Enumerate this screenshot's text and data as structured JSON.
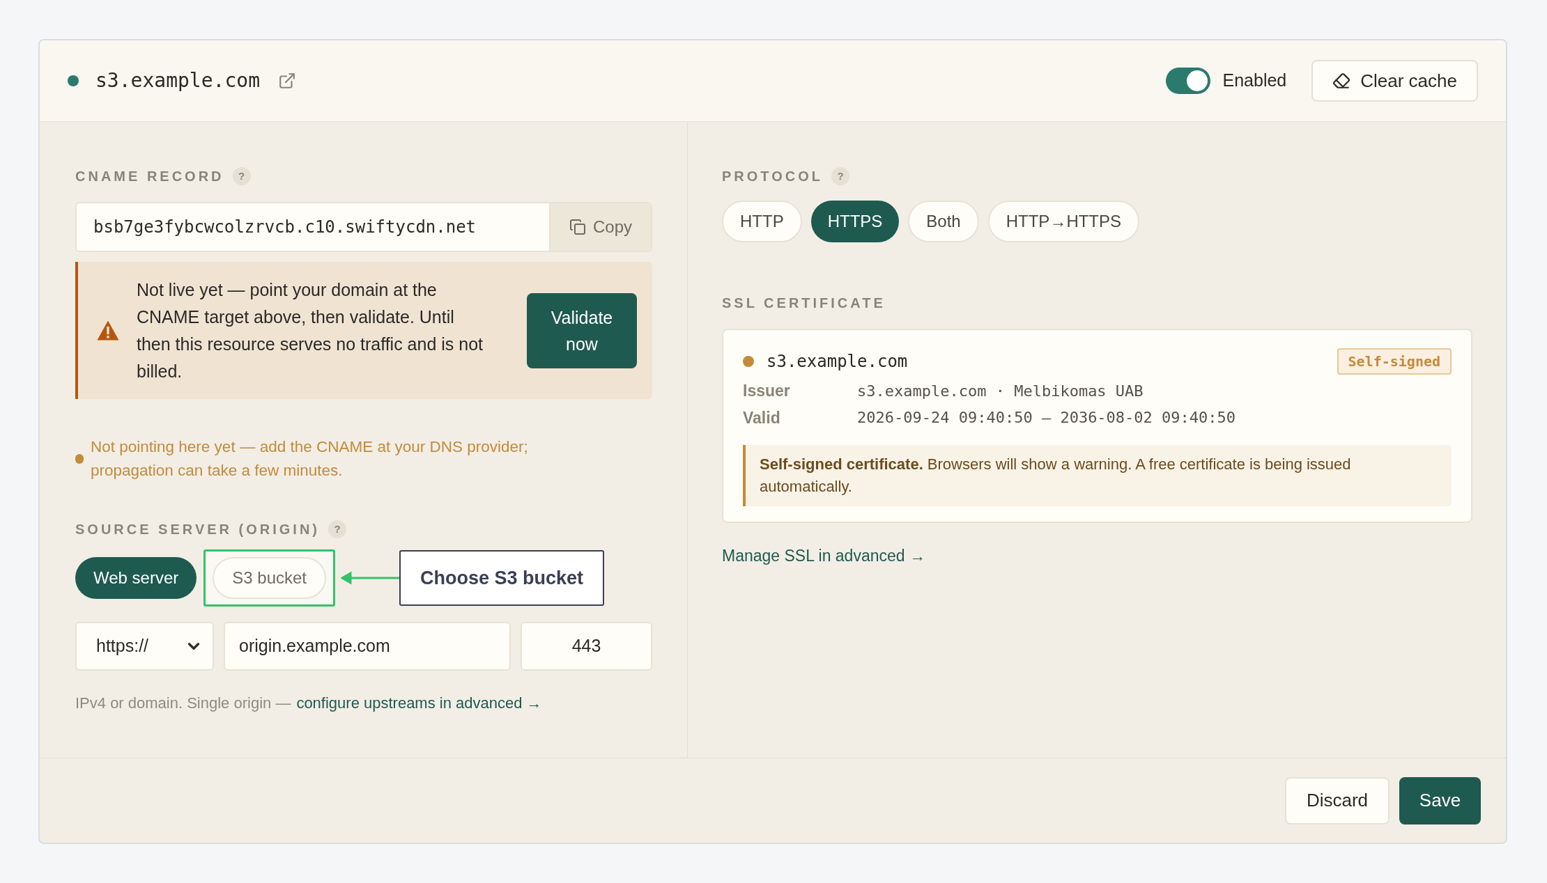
{
  "header": {
    "domain": "s3.example.com",
    "enabled": true,
    "toggle_label": "Enabled",
    "clear_cache": "Clear cache"
  },
  "cname": {
    "label": "CNAME RECORD",
    "help": "?",
    "value": "bsb7ge3fybcwcolzrvcb.c10.swiftycdn.net",
    "copy": "Copy"
  },
  "warning": {
    "text": "Not live yet — point your domain at the CNAME target above, then validate. Until then this resource serves no traffic and is not billed.",
    "button": "Validate now"
  },
  "dns_note": "Not pointing here yet — add the CNAME at your DNS provider; propagation can take a few minutes.",
  "origin": {
    "label": "SOURCE SERVER (ORIGIN)",
    "help": "?",
    "types": [
      {
        "label": "Web server",
        "selected": true,
        "highlighted": false
      },
      {
        "label": "S3 bucket",
        "selected": false,
        "highlighted": true
      }
    ],
    "scheme": "https://",
    "host": "origin.example.com",
    "port": "443",
    "hint": "IPv4 or domain. Single origin —",
    "link": "configure upstreams in advanced →"
  },
  "annotation": {
    "text": "Choose S3 bucket"
  },
  "protocol": {
    "label": "PROTOCOL",
    "help": "?",
    "options": [
      {
        "label": "HTTP",
        "selected": false
      },
      {
        "label": "HTTPS",
        "selected": true
      },
      {
        "label": "Both",
        "selected": false
      },
      {
        "label": "HTTP→HTTPS",
        "selected": false
      }
    ]
  },
  "ssl": {
    "label": "SSL CERTIFICATE",
    "domain": "s3.example.com",
    "badge": "Self-signed",
    "fields": [
      {
        "label": "Issuer",
        "value": "s3.example.com · Melbikomas UAB"
      },
      {
        "label": "Valid",
        "value": "2026-09-24 09:40:50 — 2036-08-02 09:40:50"
      }
    ],
    "notice": "**Self-signed certificate.** Browsers will show a warning. A free certificate is being issued automatically.",
    "link": "Manage SSL in advanced →"
  },
  "footer": {
    "discard": "Discard",
    "save": "Save"
  }
}
